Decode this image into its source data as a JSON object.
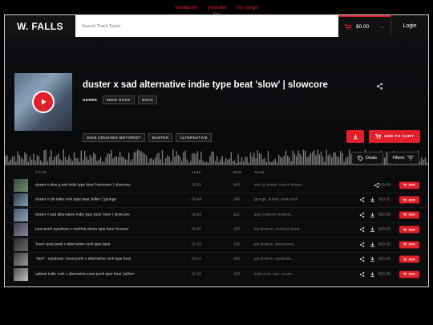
{
  "topnav": {
    "instagram": "instagram",
    "youtube": "youtube",
    "my_songs": "my songs"
  },
  "header": {
    "logo": "W. FALLS",
    "search_placeholder": "Search Track Types",
    "cart_total": "$0.00",
    "login": "Login"
  },
  "hero": {
    "title": "duster x sad alternative indie type beat 'slow' | slowcore",
    "genre_label": "GENRE",
    "genres": [
      "INDIE ROCK",
      "ROCK"
    ],
    "tags": [
      "SIGN CRUSHES MOTORIST",
      "DUSTER",
      "ALTERNATIVE"
    ],
    "add_to_cart": "ADD TO CART"
  },
  "controls": {
    "deals": "Deals",
    "filters": "Filters"
  },
  "table": {
    "headers": {
      "title": "TITLE",
      "time": "TIME",
      "bpm": "BPM",
      "tags": "TAGS"
    },
    "add_label": "ADD",
    "rows": [
      {
        "title": "duster x alex g sad indie type beat 'hurricane' | slowcore",
        "time": "02:52",
        "bpm": "106",
        "tags": "alex g, duster, beach house...",
        "price": "$29.95"
      },
      {
        "title": "duster x lofi indie rock type beat 'fallen' | grunge",
        "time": "03:44",
        "bpm": "140",
        "tags": "grunge, duster, indie rock",
        "price": "$29.95"
      },
      {
        "title": "duster x sad alternative indie type beat 'slow' | slowcore",
        "time": "02:09",
        "bpm": "115",
        "tags": "sign crushes motorist...",
        "price": "$29.95"
      },
      {
        "title": "post-punk eyedress x molchat doma type beat 'houses'",
        "time": "02:20",
        "bpm": "150",
        "tags": "joy division, molchat doma...",
        "price": "$29.95"
      },
      {
        "title": "'lover' post-punk x alternative rock type beat",
        "time": "02:32",
        "bpm": "145",
        "tags": "joy division, thexamuch...",
        "price": "$29.95"
      },
      {
        "title": "\"sick\" - eyedress / post-punk x alternative rock type beat",
        "time": "02:12",
        "bpm": "156",
        "tags": "joy division, eyedress...",
        "price": "$29.95"
      },
      {
        "title": "upbeat indie rock x alternative post-punk type beat 'yellow'",
        "time": "02:20",
        "bpm": "150",
        "tags": "indie rock, surf, cruise...",
        "price": "$29.95"
      }
    ]
  },
  "colors": {
    "accent": "#e0202a",
    "bg": "#0c0c0e"
  }
}
